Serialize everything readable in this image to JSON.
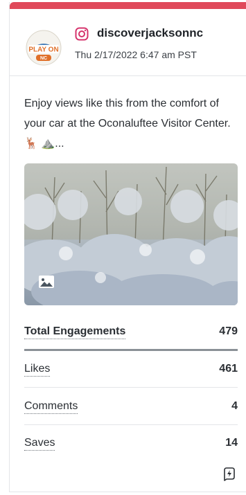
{
  "post": {
    "platform_icon": "instagram-icon",
    "handle": "discoverjacksonnc",
    "timestamp": "Thu 2/17/2022 6:47 am PST",
    "caption": "Enjoy views like this from the comfort of your car at the Oconaluftee Visitor Center. 🦌 ⛰️...",
    "logo": {
      "line1": "PLAY ON",
      "line2": "NC"
    },
    "media_icon": "image-icon"
  },
  "metrics": {
    "total": {
      "label": "Total Engagements",
      "value": "479"
    },
    "likes": {
      "label": "Likes",
      "value": "461"
    },
    "comments": {
      "label": "Comments",
      "value": "4"
    },
    "saves": {
      "label": "Saves",
      "value": "14"
    }
  },
  "colors": {
    "accent": "#e0495a",
    "instagram": "#d6336c",
    "logo_orange": "#e0702a",
    "logo_blue": "#2a6bb0"
  },
  "footer_icon": "lightning-bolt-icon"
}
